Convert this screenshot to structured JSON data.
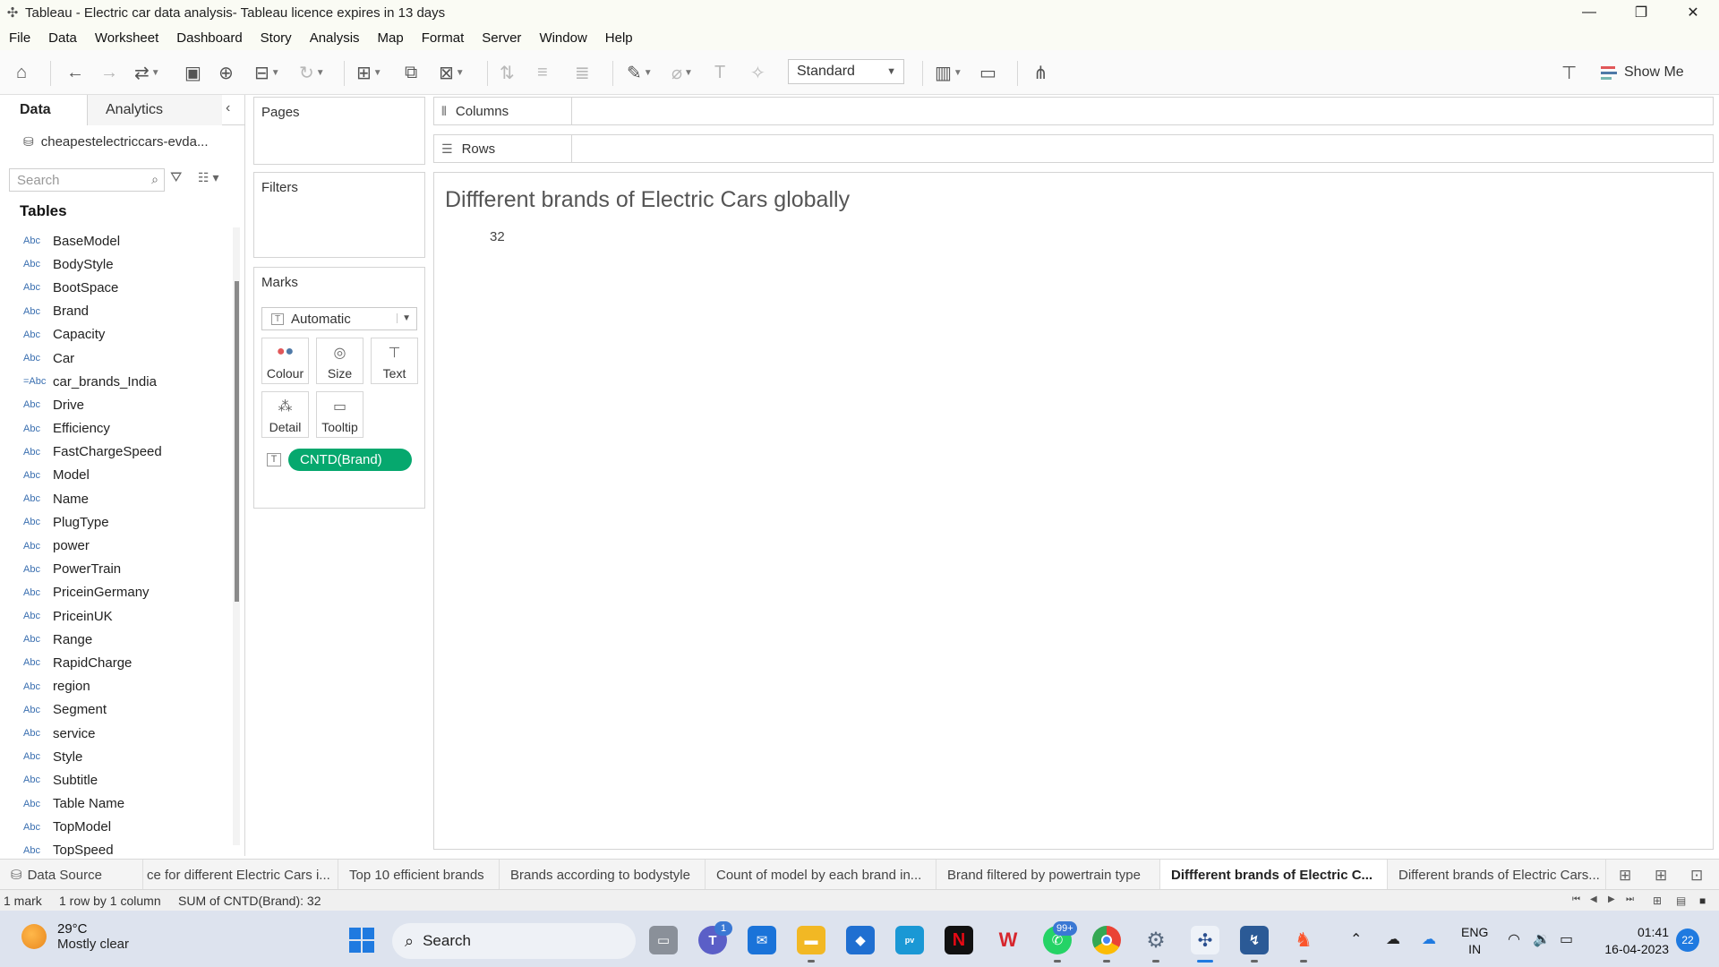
{
  "window": {
    "title": "Tableau - Electric car data analysis- Tableau licence expires in 13 days",
    "controls": [
      "—",
      "❐",
      "✕"
    ]
  },
  "menu": [
    "File",
    "Data",
    "Worksheet",
    "Dashboard",
    "Story",
    "Analysis",
    "Map",
    "Format",
    "Server",
    "Window",
    "Help"
  ],
  "toolbar": {
    "fit_value": "Standard",
    "show_me_label": "Show Me",
    "show_me_colors": [
      "#e15759",
      "#4e79a7",
      "#76b7b2"
    ]
  },
  "data_pane": {
    "tab_data": "Data",
    "tab_analytics": "Analytics",
    "datasource": "cheapestelectriccars-evda...",
    "search_placeholder": "Search",
    "tables_heading": "Tables",
    "fields": [
      {
        "type": "Abc",
        "name": "BaseModel"
      },
      {
        "type": "Abc",
        "name": "BodyStyle"
      },
      {
        "type": "Abc",
        "name": "BootSpace"
      },
      {
        "type": "Abc",
        "name": "Brand"
      },
      {
        "type": "Abc",
        "name": "Capacity"
      },
      {
        "type": "Abc",
        "name": "Car"
      },
      {
        "type": "=Abc",
        "name": "car_brands_India"
      },
      {
        "type": "Abc",
        "name": "Drive"
      },
      {
        "type": "Abc",
        "name": "Efficiency"
      },
      {
        "type": "Abc",
        "name": "FastChargeSpeed"
      },
      {
        "type": "Abc",
        "name": "Model"
      },
      {
        "type": "Abc",
        "name": "Name"
      },
      {
        "type": "Abc",
        "name": "PlugType"
      },
      {
        "type": "Abc",
        "name": "power"
      },
      {
        "type": "Abc",
        "name": "PowerTrain"
      },
      {
        "type": "Abc",
        "name": "PriceinGermany"
      },
      {
        "type": "Abc",
        "name": "PriceinUK"
      },
      {
        "type": "Abc",
        "name": "Range"
      },
      {
        "type": "Abc",
        "name": "RapidCharge"
      },
      {
        "type": "Abc",
        "name": "region"
      },
      {
        "type": "Abc",
        "name": "Segment"
      },
      {
        "type": "Abc",
        "name": "service"
      },
      {
        "type": "Abc",
        "name": "Style"
      },
      {
        "type": "Abc",
        "name": "Subtitle"
      },
      {
        "type": "Abc",
        "name": "Table Name"
      },
      {
        "type": "Abc",
        "name": "TopModel"
      },
      {
        "type": "Abc",
        "name": "TopSpeed"
      }
    ]
  },
  "cards": {
    "pages": "Pages",
    "filters": "Filters",
    "marks": "Marks",
    "mark_type": "Automatic",
    "mark_buttons": {
      "colour": "Colour",
      "size": "Size",
      "text": "Text",
      "detail": "Detail",
      "tooltip": "Tooltip"
    },
    "pill": "CNTD(Brand)",
    "pill_color": "#06a86e"
  },
  "shelves": {
    "columns": "Columns",
    "rows": "Rows"
  },
  "view": {
    "title": "Diffferent brands of Electric Cars globally",
    "value": "32"
  },
  "sheet_tabs": {
    "data_source": "Data Source",
    "tabs": [
      "ce for different Electric Cars i...",
      "Top 10 efficient brands",
      "Brands according to bodystyle",
      "Count of model by each brand in...",
      "Brand filtered by powertrain type",
      "Diffferent brands of Electric C...",
      "Different brands of Electric Cars..."
    ],
    "active_index": 5
  },
  "status": {
    "marks": "1 mark",
    "dims": "1 row by 1 column",
    "sum": "SUM of CNTD(Brand): 32"
  },
  "taskbar": {
    "weather_temp": "29°C",
    "weather_desc": "Mostly clear",
    "search_label": "Search",
    "badge_teams": "1",
    "badge_whatsapp": "99+",
    "lang_1": "ENG",
    "lang_2": "IN",
    "time": "01:41",
    "date": "16-04-2023",
    "notif_count": "22"
  }
}
